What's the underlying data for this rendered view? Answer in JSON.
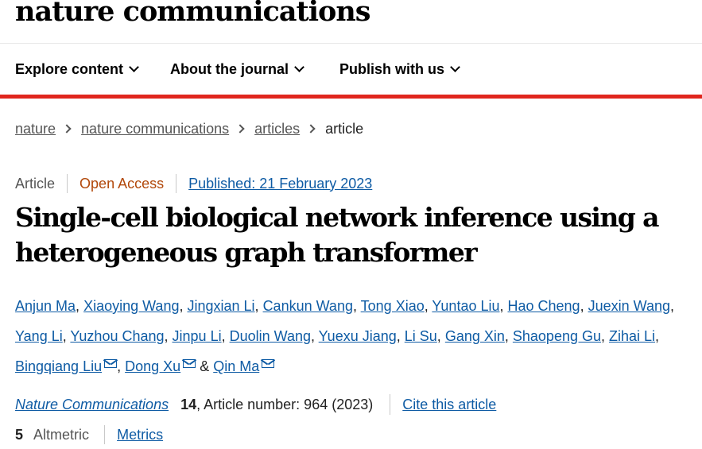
{
  "header": {
    "brand": "nature communications",
    "nav": [
      "Explore content",
      "About the journal",
      "Publish with us"
    ]
  },
  "colors": {
    "accent_bar": "#e0261d",
    "link": "#0e5ba4",
    "open_access": "#b2480a"
  },
  "breadcrumb": [
    "nature",
    "nature communications",
    "articles",
    "article"
  ],
  "article": {
    "type": "Article",
    "access": "Open Access",
    "published": "Published: 21 February 2023",
    "title": "Single-cell biological network inference using a heterogeneous graph transformer",
    "authors": [
      "Anjun Ma",
      "Xiaoying Wang",
      "Jingxian Li",
      "Cankun Wang",
      "Tong Xiao",
      "Yuntao Liu",
      "Hao Cheng",
      "Juexin Wang",
      "Yang Li",
      "Yuzhou Chang",
      "Jinpu Li",
      "Duolin Wang",
      "Yuexu Jiang",
      "Li Su",
      "Gang Xin",
      "Shaopeng Gu",
      "Zihai Li",
      "Bingqiang Liu",
      "Dong Xu",
      "Qin Ma"
    ],
    "corresponding": [
      "Bingqiang Liu",
      "Dong Xu",
      "Qin Ma"
    ],
    "author_ampersand": "&",
    "journal": "Nature Communications",
    "volume": "14",
    "article_number": ", Article number: 964 (2023)",
    "cite_label": "Cite this article",
    "altmetric_count": "5",
    "altmetric_label": "Altmetric",
    "metrics_label": "Metrics"
  }
}
